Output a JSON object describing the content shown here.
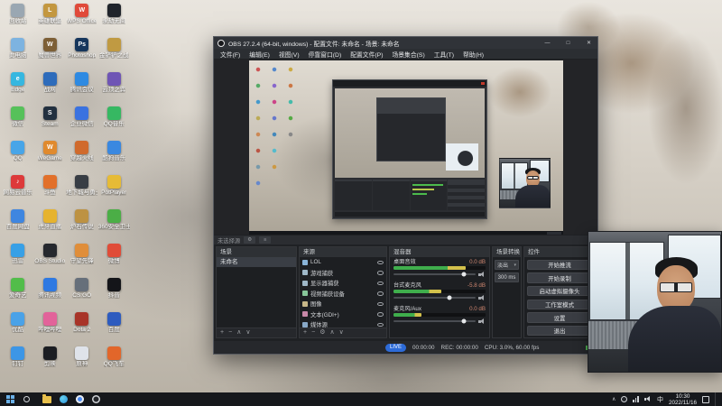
{
  "desktop": {
    "icons": [
      {
        "label": "回收站",
        "color": "#9aa7b2",
        "glyph": ""
      },
      {
        "label": "此电脑",
        "color": "#7db3e0",
        "glyph": ""
      },
      {
        "label": "Edge",
        "color": "#36b7e0",
        "glyph": "e"
      },
      {
        "label": "微信",
        "color": "#56c15a",
        "glyph": ""
      },
      {
        "label": "QQ",
        "color": "#48a5e8",
        "glyph": ""
      },
      {
        "label": "网易云音乐",
        "color": "#dd3a3a",
        "glyph": "♪"
      },
      {
        "label": "百度网盘",
        "color": "#3f86e0",
        "glyph": ""
      },
      {
        "label": "迅雷",
        "color": "#38a0e6",
        "glyph": ""
      },
      {
        "label": "爱奇艺",
        "color": "#52bd4a",
        "glyph": ""
      },
      {
        "label": "优酷",
        "color": "#4aa2e8",
        "glyph": ""
      },
      {
        "label": "钉钉",
        "color": "#3d96e6",
        "glyph": ""
      },
      {
        "label": "英雄联盟",
        "color": "#c3973f",
        "glyph": "L"
      },
      {
        "label": "魔兽世界",
        "color": "#7d5f36",
        "glyph": "W"
      },
      {
        "label": "战网",
        "color": "#2e6cbb",
        "glyph": ""
      },
      {
        "label": "Steam",
        "color": "#22303f",
        "glyph": "S"
      },
      {
        "label": "WeGame",
        "color": "#e08a2e",
        "glyph": "W"
      },
      {
        "label": "斗鱼",
        "color": "#e2702a",
        "glyph": ""
      },
      {
        "label": "虎牙直播",
        "color": "#e6b32e",
        "glyph": ""
      },
      {
        "label": "OBS Studio",
        "color": "#26292e",
        "glyph": ""
      },
      {
        "label": "腾讯视频",
        "color": "#2e79e2",
        "glyph": ""
      },
      {
        "label": "哔哩哔哩",
        "color": "#e2639a",
        "glyph": ""
      },
      {
        "label": "剪映",
        "color": "#1b1d22",
        "glyph": ""
      },
      {
        "label": "WPS Office",
        "color": "#e04a3a",
        "glyph": "W"
      },
      {
        "label": "Photoshop",
        "color": "#16365c",
        "glyph": "Ps"
      },
      {
        "label": "腾讯会议",
        "color": "#2e8ae2",
        "glyph": ""
      },
      {
        "label": "企业微信",
        "color": "#3a72e0",
        "glyph": ""
      },
      {
        "label": "穿越火线",
        "color": "#d06a2c",
        "glyph": ""
      },
      {
        "label": "地下城与勇士",
        "color": "#383d44",
        "glyph": ""
      },
      {
        "label": "炉石传说",
        "color": "#bd9242",
        "glyph": ""
      },
      {
        "label": "守望先锋",
        "color": "#e08e3a",
        "glyph": ""
      },
      {
        "label": "CS:GO",
        "color": "#666f7a",
        "glyph": ""
      },
      {
        "label": "Dota 2",
        "color": "#a83428",
        "glyph": ""
      },
      {
        "label": "原神",
        "color": "#dfe3ea",
        "glyph": ""
      },
      {
        "label": "永劫无间",
        "color": "#20242b",
        "glyph": ""
      },
      {
        "label": "金铲铲之战",
        "color": "#c09a42",
        "glyph": ""
      },
      {
        "label": "云顶之弈",
        "color": "#6f55b5",
        "glyph": ""
      },
      {
        "label": "QQ音乐",
        "color": "#36b862",
        "glyph": ""
      },
      {
        "label": "酷狗音乐",
        "color": "#3a88e0",
        "glyph": ""
      },
      {
        "label": "PotPlayer",
        "color": "#e6bb36",
        "glyph": ""
      },
      {
        "label": "360安全卫士",
        "color": "#4bae46",
        "glyph": ""
      },
      {
        "label": "微博",
        "color": "#e04c38",
        "glyph": ""
      },
      {
        "label": "抖音",
        "color": "#141519",
        "glyph": ""
      },
      {
        "label": "百度",
        "color": "#2d5bbf",
        "glyph": ""
      },
      {
        "label": "QQ飞车",
        "color": "#e2662a",
        "glyph": ""
      }
    ]
  },
  "obs": {
    "title": "OBS 27.2.4 (64-bit, windows) - 配置文件: 未命名 - 场景: 未命名",
    "win_buttons": {
      "min": "—",
      "max": "□",
      "close": "✕"
    },
    "menu": [
      "文件(F)",
      "编辑(E)",
      "视图(V)",
      "停靠窗口(D)",
      "配置文件(P)",
      "场景集合(S)",
      "工具(T)",
      "帮助(H)"
    ],
    "source_toolbar": {
      "no_source": "未选择源",
      "gear": "⚙",
      "filter": "≡"
    },
    "docks": {
      "scenes": {
        "title": "场景",
        "items": [
          "未命名"
        ],
        "toolbar": [
          "+",
          "−",
          "∧",
          "∨"
        ]
      },
      "sources": {
        "title": "来源",
        "items": [
          {
            "label": "LOL",
            "icon_color": "#8ab4d8"
          },
          {
            "label": "游戏捕获",
            "icon_color": "#9fb8c8"
          },
          {
            "label": "显示器捕获",
            "icon_color": "#9fb8c8"
          },
          {
            "label": "视频捕获设备",
            "icon_color": "#88c79a"
          },
          {
            "label": "图像",
            "icon_color": "#c7b788"
          },
          {
            "label": "文本(GDI+)",
            "icon_color": "#c788a8"
          },
          {
            "label": "媒体源",
            "icon_color": "#88a8c7"
          }
        ],
        "toolbar": [
          "+",
          "−",
          "⚙",
          "∧",
          "∨"
        ]
      },
      "mixer": {
        "title": "混音器",
        "channels": [
          {
            "name": "桌面音效",
            "db": "0.0 dB",
            "level": "78%",
            "slider": "86%"
          },
          {
            "name": "台式麦克风",
            "db": "-5.8 dB",
            "level": "52%",
            "slider": "68%"
          },
          {
            "name": "麦克风/Aux",
            "db": "0.0 dB",
            "level": "30%",
            "slider": "86%"
          }
        ]
      },
      "transitions": {
        "title": "场景转换",
        "selected": "淡出",
        "arrow": "▾",
        "duration": "300 ms"
      },
      "controls": {
        "title": "控件",
        "buttons": [
          "开始推流",
          "开始录制",
          "启动虚拟摄像头",
          "工作室模式",
          "设置",
          "退出"
        ]
      }
    },
    "status": {
      "badge": "LIVE",
      "live_time": "00:00:00",
      "rec": "REC: 00:00:00",
      "cpu": "CPU: 3.0%, 60.00 fps"
    }
  },
  "taskbar": {
    "chevron": "∧",
    "ime": "中",
    "time": "10:30",
    "date": "2022/11/16"
  }
}
